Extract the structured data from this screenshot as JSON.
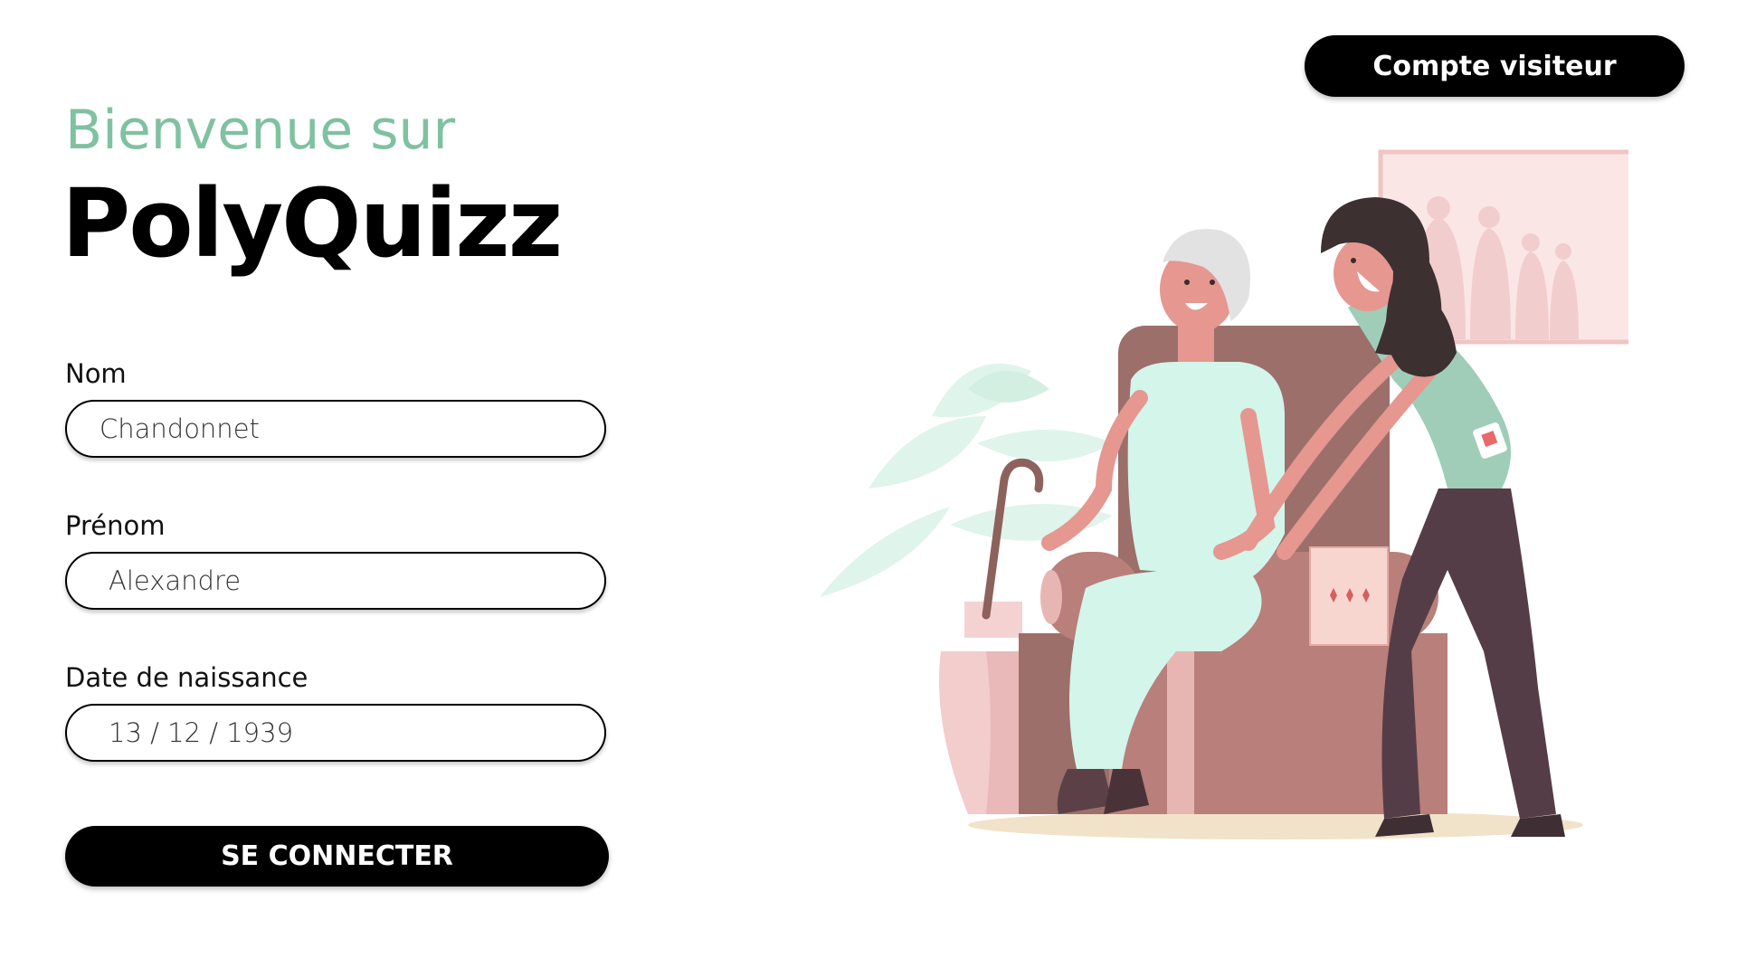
{
  "header": {
    "visitor_button_label": "Compte visiteur"
  },
  "welcome": {
    "subtitle": "Bienvenue sur",
    "title": "PolyQuizz"
  },
  "form": {
    "last_name": {
      "label": "Nom",
      "value": "Chandonnet"
    },
    "first_name": {
      "label": "Prénom",
      "value": "Alexandre"
    },
    "birth_date": {
      "label": "Date de naissance",
      "value": "13 / 12 / 1939"
    },
    "submit_label": "SE CONNECTER"
  },
  "colors": {
    "accent_green": "#7fc1a1",
    "button_bg": "#000000",
    "button_text": "#ffffff"
  },
  "illustration": {
    "icon": "caregiver-elderly-illustration"
  }
}
